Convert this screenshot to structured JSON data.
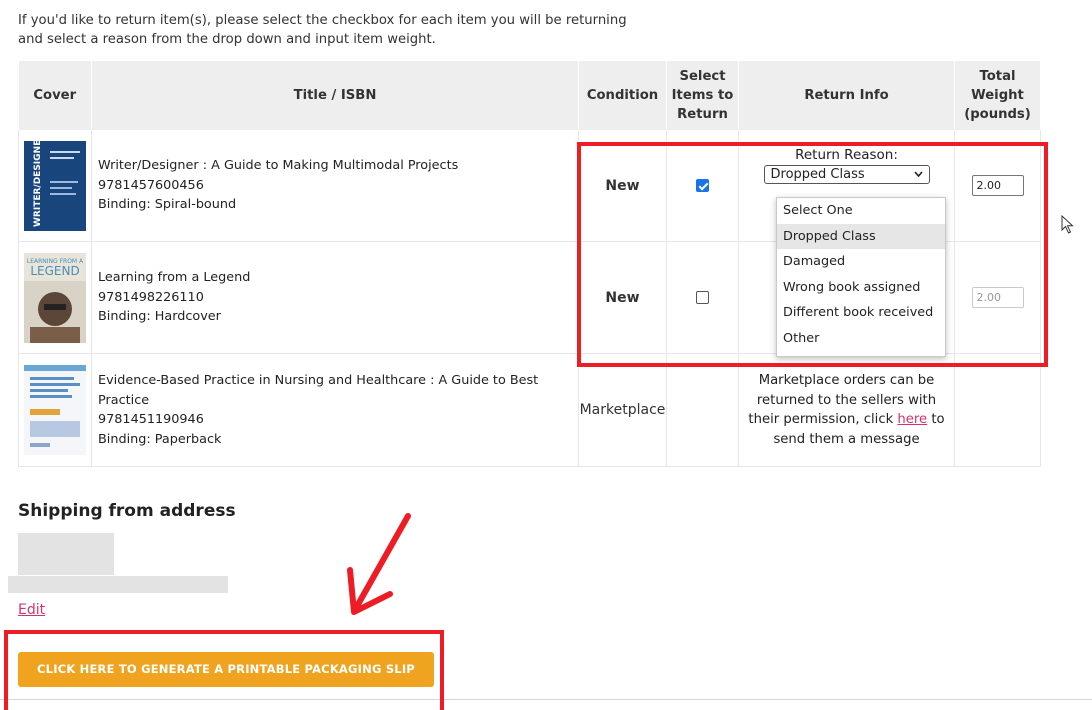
{
  "intro_text": "If you'd like to return item(s), please select the checkbox for each item you will be returning\nand select a reason from the drop down and input item weight.",
  "table": {
    "headers": {
      "cover": "Cover",
      "title": "Title / ISBN",
      "condition": "Condition",
      "select": "Select Items to Return",
      "return_info": "Return Info",
      "weight": "Total Weight (pounds)"
    },
    "rows": [
      {
        "cover_icon": "writer-designer-cover",
        "title": "Writer/Designer : A Guide to Making Multimodal Projects",
        "isbn": "9781457600456",
        "binding": "Binding: Spiral-bound",
        "condition": "New",
        "checked": true,
        "return_reason_label": "Return Reason:",
        "return_reason_value": "Dropped Class",
        "weight": "2.00"
      },
      {
        "cover_icon": "learning-from-a-legend-cover",
        "cover_text_1": "LEARNING FROM A",
        "cover_text_2": "LEGEND",
        "title": "Learning from a Legend",
        "isbn": "9781498226110",
        "binding": "Binding: Hardcover",
        "condition": "New",
        "checked": false,
        "weight": "2.00"
      },
      {
        "cover_icon": "evidence-based-practice-cover",
        "title": "Evidence-Based Practice in Nursing and Healthcare : A Guide to Best Practice",
        "isbn": "9781451190946",
        "binding": "Binding: Paperback",
        "condition": "Marketplace",
        "note_before": "Marketplace orders can be returned to the sellers with their permission, click ",
        "note_link": "here",
        "note_after": " to send them a message"
      }
    ]
  },
  "dropdown_options": [
    "Select One",
    "Dropped Class",
    "Damaged",
    "Wrong book assigned",
    "Different book received",
    "Other"
  ],
  "shipping": {
    "title": "Shipping from address",
    "edit_label": "Edit"
  },
  "generate_button_label": "CLICK HERE TO GENERATE A PRINTABLE PACKAGING SLIP",
  "colors": {
    "accent_orange": "#f0a31e",
    "link_pink": "#d6336c",
    "annotation_red": "#ee1c24",
    "checkbox_blue": "#1a73e8"
  }
}
